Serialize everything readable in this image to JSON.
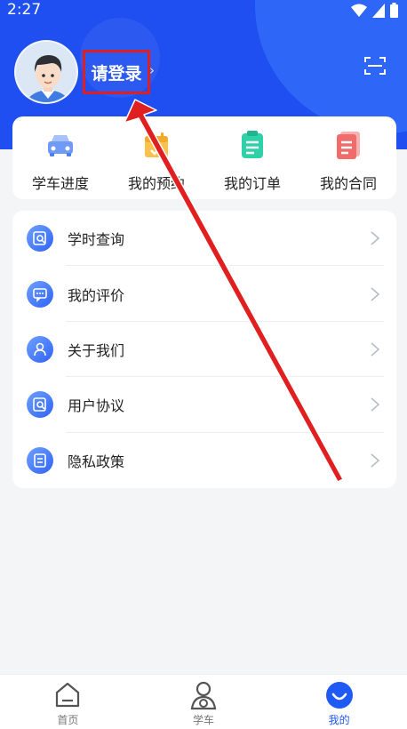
{
  "status_bar": {
    "time": "2:27"
  },
  "header": {
    "login_label": "请登录",
    "accent_color": "#1f4ff0"
  },
  "shortcuts": [
    {
      "label": "学车进度",
      "icon": "car-icon"
    },
    {
      "label": "我的预约",
      "icon": "calendar-icon"
    },
    {
      "label": "我的订单",
      "icon": "order-list-icon"
    },
    {
      "label": "我的合同",
      "icon": "contract-icon"
    }
  ],
  "menu": [
    {
      "label": "学时查询",
      "icon": "record-search-icon"
    },
    {
      "label": "我的评价",
      "icon": "comment-icon"
    },
    {
      "label": "关于我们",
      "icon": "person-icon"
    },
    {
      "label": "用户协议",
      "icon": "agreement-icon"
    },
    {
      "label": "隐私政策",
      "icon": "privacy-doc-icon"
    }
  ],
  "tabbar": {
    "tabs": [
      {
        "label": "首页",
        "icon": "home-icon"
      },
      {
        "label": "学车",
        "icon": "learner-icon"
      },
      {
        "label": "我的",
        "icon": "profile-icon",
        "active": true
      }
    ],
    "active_color": "#1f5af5"
  },
  "annotation": {
    "highlight_color": "#e02020"
  }
}
